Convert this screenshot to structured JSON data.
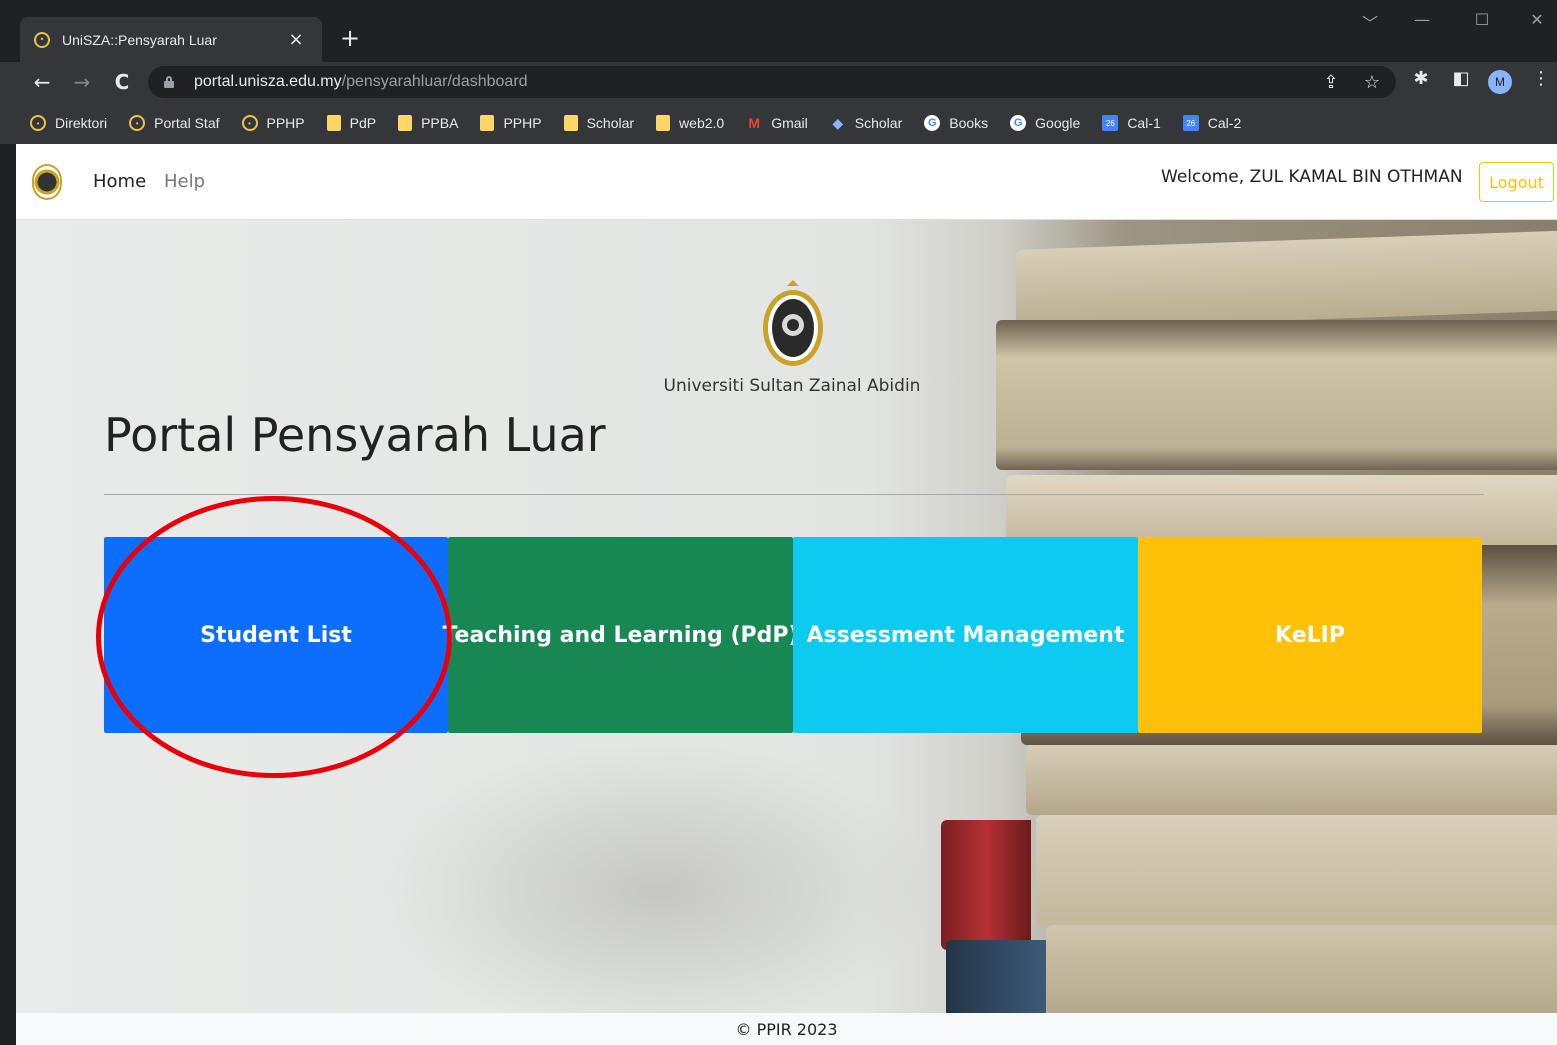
{
  "browser": {
    "tab_title": "UniSZA::Pensyarah Luar",
    "tab_close": "×",
    "new_tab": "+",
    "url_host": "portal.unisza.edu.my",
    "url_path": "/pensyarahluar/dashboard",
    "profile_initial": "M",
    "window_controls": [
      "﹀",
      "—",
      "☐",
      "✕"
    ]
  },
  "bookmarks": [
    {
      "label": "Direktori",
      "icon": "unisza-icon"
    },
    {
      "label": "Portal Staf",
      "icon": "unisza-icon"
    },
    {
      "label": "PPHP",
      "icon": "unisza-icon"
    },
    {
      "label": "PdP",
      "icon": "folder-icon"
    },
    {
      "label": "PPBA",
      "icon": "folder-icon"
    },
    {
      "label": "PPHP",
      "icon": "folder-icon"
    },
    {
      "label": "Scholar",
      "icon": "folder-icon"
    },
    {
      "label": "web2.0",
      "icon": "folder-icon"
    },
    {
      "label": "Gmail",
      "icon": "gmail-icon"
    },
    {
      "label": "Scholar",
      "icon": "scholar-icon"
    },
    {
      "label": "Books",
      "icon": "google-icon"
    },
    {
      "label": "Google",
      "icon": "google-icon"
    },
    {
      "label": "Cal-1",
      "icon": "calendar-icon"
    },
    {
      "label": "Cal-2",
      "icon": "calendar-icon"
    }
  ],
  "navbar": {
    "home": "Home",
    "help": "Help",
    "welcome": "Welcome, ZUL KAMAL BIN OTHMAN",
    "logout": "Logout"
  },
  "hero": {
    "university": "Universiti Sultan Zainal Abidin",
    "title": "Portal Pensyarah Luar"
  },
  "tiles": [
    {
      "label": "Student List",
      "color": "#0d6efd"
    },
    {
      "label": "Teaching and Learning (PdP)",
      "color": "#198754"
    },
    {
      "label": "Assessment Management",
      "color": "#0dcaf0"
    },
    {
      "label": "KeLIP",
      "color": "#ffc107"
    }
  ],
  "footer": "© PPIR 2023",
  "colors": {
    "highlight_ellipse": "#e8000b",
    "logout_border": "#ffc107"
  }
}
